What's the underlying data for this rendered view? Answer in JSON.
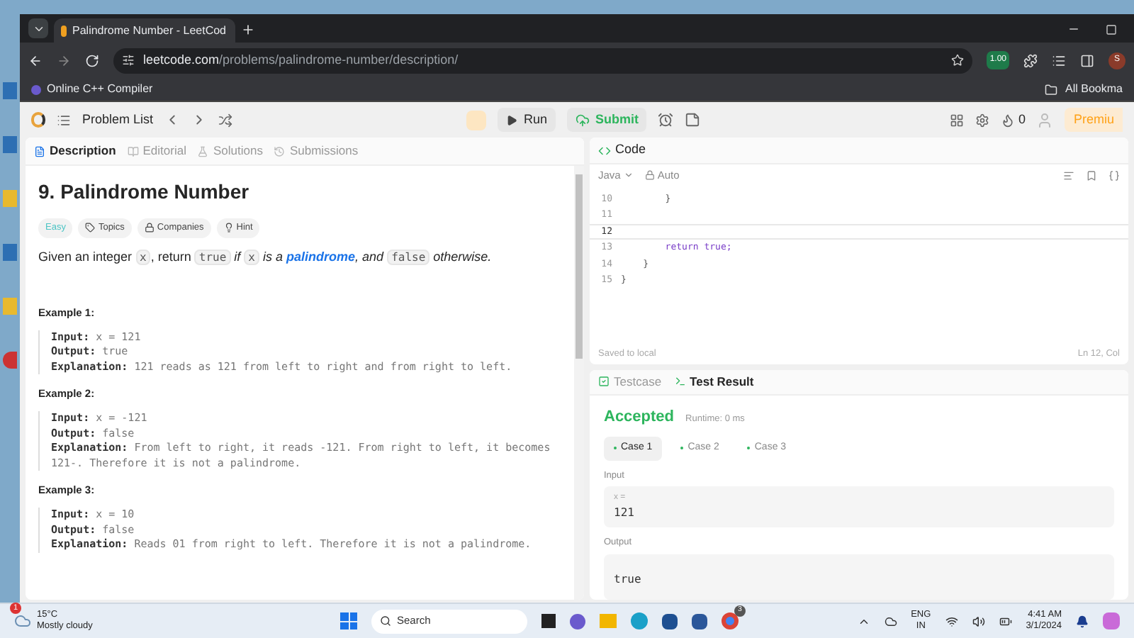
{
  "browser": {
    "tab_title": "Palindrome Number - LeetCod",
    "url_host": "leetcode.com",
    "url_path": "/problems/palindrome-number/description/",
    "extension_badge": "1.00",
    "profile_initial": "S",
    "bookmarks": [
      {
        "label": "Online C++ Compiler"
      }
    ],
    "all_bookmarks": "All Bookma"
  },
  "header": {
    "problem_list": "Problem List",
    "run": "Run",
    "submit": "Submit",
    "streak": "0",
    "premium": "Premiu"
  },
  "left_tabs": [
    {
      "label": "Description",
      "selected": true
    },
    {
      "label": "Editorial",
      "selected": false
    },
    {
      "label": "Solutions",
      "selected": false
    },
    {
      "label": "Submissions",
      "selected": false
    }
  ],
  "problem": {
    "title": "9. Palindrome Number",
    "difficulty": "Easy",
    "tags": [
      "Topics",
      "Companies",
      "Hint"
    ],
    "description": [
      {
        "kind": "text",
        "text": "Given an integer "
      },
      {
        "kind": "code",
        "text": "x"
      },
      {
        "kind": "text",
        "text": ", return "
      },
      {
        "kind": "code",
        "text": "true"
      },
      {
        "kind": "italic",
        "text": " if "
      },
      {
        "kind": "code",
        "text": "x"
      },
      {
        "kind": "italic",
        "text": " is a "
      },
      {
        "kind": "link",
        "text": "palindrome"
      },
      {
        "kind": "italic",
        "text": ", and "
      },
      {
        "kind": "code",
        "text": "false"
      },
      {
        "kind": "italic",
        "text": " otherwise."
      }
    ],
    "examples": [
      {
        "title": "Example 1:",
        "lines": [
          {
            "label": "Input:",
            "value": "x = 121"
          },
          {
            "label": "Output:",
            "value": "true"
          },
          {
            "label": "Explanation:",
            "value": "121 reads as 121 from left to right and from right to left."
          }
        ]
      },
      {
        "title": "Example 2:",
        "lines": [
          {
            "label": "Input:",
            "value": "x = -121"
          },
          {
            "label": "Output:",
            "value": "false"
          },
          {
            "label": "Explanation:",
            "value": "From left to right, it reads -121. From right to left, it becomes 121-. Therefore it is not a palindrome."
          }
        ]
      },
      {
        "title": "Example 3:",
        "lines": [
          {
            "label": "Input:",
            "value": "x = 10"
          },
          {
            "label": "Output:",
            "value": "false"
          },
          {
            "label": "Explanation:",
            "value": "Reads 01 from right to left. Therefore it is not a palindrome."
          }
        ]
      }
    ]
  },
  "code_panel": {
    "title": "Code",
    "language": "Java",
    "mode": "Auto",
    "lines": [
      {
        "number": "10",
        "text": "        }",
        "kind": "plain",
        "current": false
      },
      {
        "number": "11",
        "kind": "plain",
        "current": false
      },
      {
        "number": "12",
        "kind": "plain",
        "current": true
      },
      {
        "number": "13",
        "text": "        return true;",
        "kind": "keyword",
        "current": false
      },
      {
        "number": "14",
        "text": "    }",
        "kind": "plain",
        "current": false
      },
      {
        "number": "15",
        "text": "}",
        "kind": "plain",
        "current": false
      }
    ],
    "saved": "Saved to local",
    "cursor": "Ln 12, Col"
  },
  "result_tabs": [
    {
      "label": "Testcase",
      "selected": false
    },
    {
      "label": "Test Result",
      "selected": true
    }
  ],
  "result": {
    "status": "Accepted",
    "runtime": "Runtime: 0 ms",
    "cases": [
      {
        "label": "Case 1",
        "selected": true
      },
      {
        "label": "Case 2",
        "selected": false
      },
      {
        "label": "Case 3",
        "selected": false
      }
    ],
    "input_label": "Input",
    "input_var": "x =",
    "input_value": "121",
    "output_label": "Output",
    "output_value": "true"
  },
  "taskbar": {
    "weather_badge": "1",
    "temperature": "15°C",
    "weather": "Mostly cloudy",
    "search": "Search",
    "chrome_badge": "3",
    "lang": "ENG",
    "region": "IN",
    "time": "4:41 AM",
    "date": "3/1/2024"
  }
}
